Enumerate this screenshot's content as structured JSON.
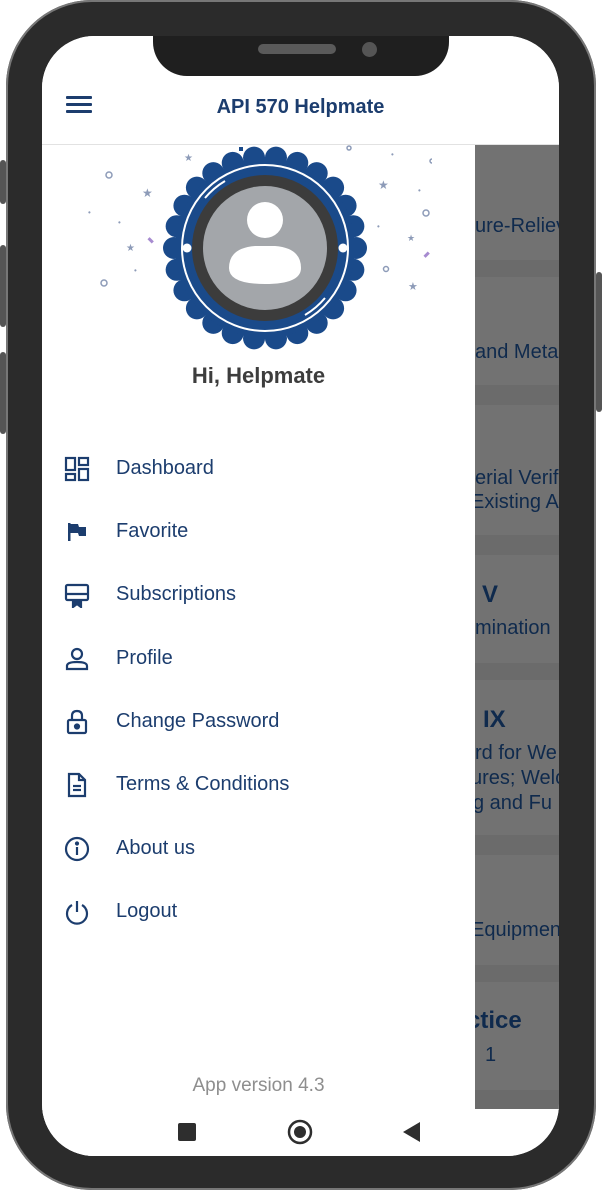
{
  "app_bar": {
    "title": "API 570 Helpmate",
    "menu_icon": "hamburger-menu-icon"
  },
  "drawer": {
    "avatar_icon": "user-avatar-icon",
    "badge_icon": "seal-badge-icon",
    "greeting": "Hi, Helpmate",
    "items": [
      {
        "label": "Dashboard",
        "icon": "dashboard-icon"
      },
      {
        "label": "Favorite",
        "icon": "flag-icon"
      },
      {
        "label": "Subscriptions",
        "icon": "subscriptions-icon"
      },
      {
        "label": "Profile",
        "icon": "person-icon"
      },
      {
        "label": "Change Password",
        "icon": "lock-icon"
      },
      {
        "label": "Terms & Conditions",
        "icon": "document-icon"
      },
      {
        "label": "About us",
        "icon": "info-icon"
      },
      {
        "label": "Logout",
        "icon": "power-icon"
      }
    ],
    "version": "App version 4.3"
  },
  "background_cards": [
    {
      "text": "ure-Reliev"
    },
    {
      "text": "and Meta"
    },
    {
      "text": "erial Verif"
    },
    {
      "text": "Existing A"
    },
    {
      "text": "V"
    },
    {
      "text": "mination"
    },
    {
      "text": "IX"
    },
    {
      "text": "rd for We"
    },
    {
      "text": "ures; Welc"
    },
    {
      "text": "g and Fu"
    },
    {
      "text": "Equipmen"
    },
    {
      "text": "ctice"
    },
    {
      "text": "1"
    }
  ],
  "system_nav": {
    "recents_icon": "square-recents-icon",
    "home_icon": "circle-home-icon",
    "back_icon": "triangle-back-icon"
  },
  "colors": {
    "primary": "#1c3d6e",
    "badge_blue": "#1a4a8a",
    "scrim": "#6b6b6b",
    "text_muted": "#8e8e8e"
  }
}
